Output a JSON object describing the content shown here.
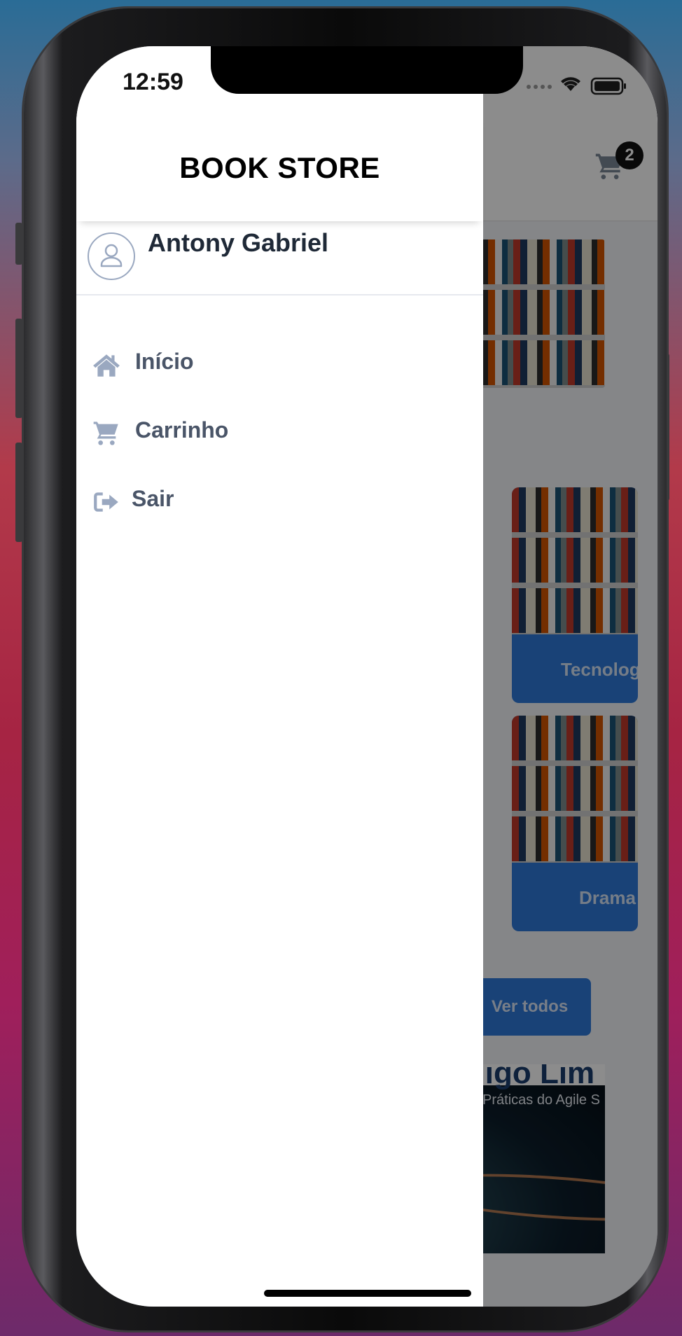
{
  "status_bar": {
    "time": "12:59"
  },
  "drawer": {
    "brand": "BOOK STORE",
    "user_name": "Antony Gabriel",
    "menu": [
      {
        "label": "Início",
        "icon": "home-icon"
      },
      {
        "label": "Carrinho",
        "icon": "cart-icon"
      },
      {
        "label": "Sair",
        "icon": "sign-out-icon"
      }
    ]
  },
  "background_app": {
    "cart_count": "2",
    "categories": [
      "Tecnolog",
      "Drama"
    ],
    "ver_todos": "Ver todos",
    "cover_title": "ódigo Lim",
    "cover_subtitle": "dades Práticas do Agile S"
  },
  "colors": {
    "accent": "#2f79d9",
    "drawer_text": "#4a5568",
    "icon": "#9aa8c0"
  }
}
